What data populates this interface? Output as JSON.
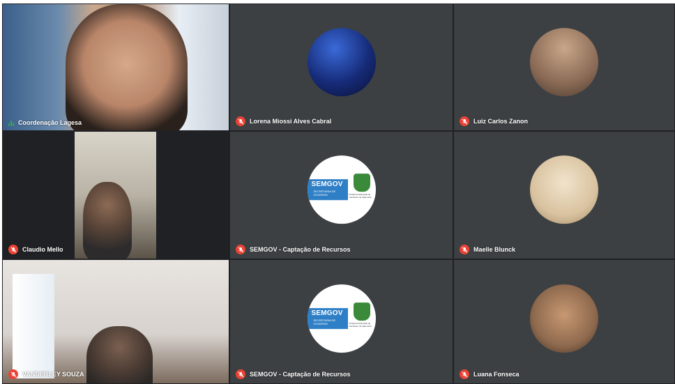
{
  "participants": [
    {
      "name": "Coordenação Lagesa",
      "mic": "speaking",
      "view": "video"
    },
    {
      "name": "Lorena Miossi Alves Cabral",
      "mic": "muted",
      "view": "avatar"
    },
    {
      "name": "Luiz Carlos Zanon",
      "mic": "muted",
      "view": "avatar"
    },
    {
      "name": "Claudio Mello",
      "mic": "muted",
      "view": "video"
    },
    {
      "name": "SEMGOV - Captação de Recursos",
      "mic": "muted",
      "view": "avatar"
    },
    {
      "name": "Maelle Blunck",
      "mic": "muted",
      "view": "avatar"
    },
    {
      "name": "VANDERLEY SOUZA",
      "mic": "muted",
      "view": "video"
    },
    {
      "name": "SEMGOV - Captação de Recursos",
      "mic": "muted",
      "view": "avatar"
    },
    {
      "name": "Luana Fonseca",
      "mic": "muted",
      "view": "avatar"
    }
  ],
  "semgov_logo": {
    "title": "SEMGOV",
    "subtitle_line1": "SECRETARIA DE",
    "subtitle_line2": "GOVERNO",
    "caption": "Prefeitura Municipal de Cachoeiro de Itapemirim"
  },
  "colors": {
    "background": "#202124",
    "tile": "#3c4043",
    "muted_red": "#ea4335",
    "speaking_green": "#34a853",
    "semgov_blue": "#2f7fc6"
  }
}
